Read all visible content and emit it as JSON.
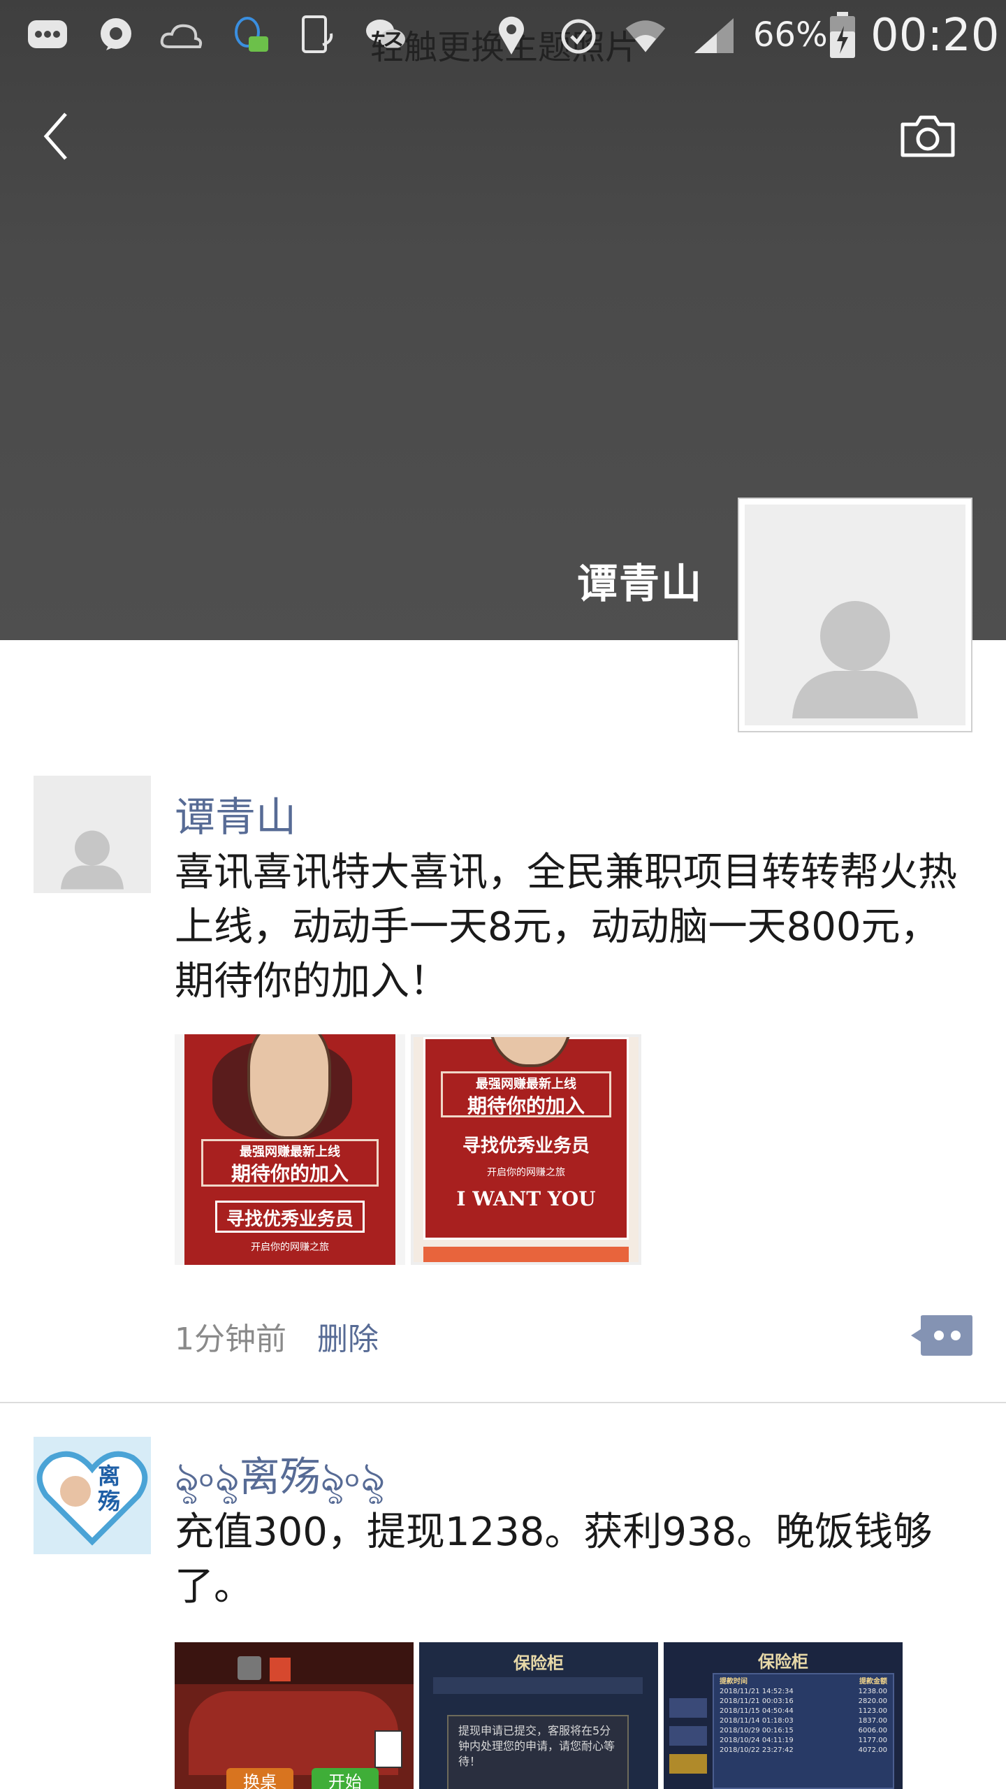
{
  "status_bar": {
    "battery_percent": "66%",
    "time": "00:20",
    "overlay_hint": "轻触更换主题照片",
    "icons": [
      "message-icon",
      "chat-bubble-icon",
      "weather-icon",
      "qq-icon",
      "phone-sync-icon",
      "wechat-icon",
      "location-icon",
      "alarm-icon",
      "wifi-icon",
      "signal-icon",
      "battery-icon"
    ]
  },
  "header": {
    "back_icon": "chevron-left-icon",
    "camera_icon": "camera-icon",
    "cover_name": "谭青山"
  },
  "posts": [
    {
      "author": "谭青山",
      "text": "喜讯喜讯特大喜讯，全民兼职项目转转帮火热上线，动动手一天8元，动动脑一天800元，期待你的加入！",
      "images": [
        {
          "headline": "最强网赚最新上线",
          "title": "期待你的加入",
          "subtitle": "寻找优秀业务员",
          "footer": "开启你的网赚之旅"
        },
        {
          "headline": "最强网赚最新上线",
          "title": "期待你的加入",
          "subtitle": "寻找优秀业务员",
          "footer": "开启你的网赚之旅",
          "tag": "I WANT YOU"
        }
      ],
      "time": "1分钟前",
      "delete_label": "删除"
    },
    {
      "author": "ৡ৹ৡ离殇ৡ৹ৡ",
      "avatar_text": "离殇",
      "text": "充值300，提现1238。获利938。晚饭钱够了。",
      "images": [
        {
          "label_left": "换桌",
          "label_right": "开始"
        },
        {
          "title": "保险柜",
          "notice": "提现申请已提交，客服将在5分钟内处理您的申请，请您耐心等待！"
        },
        {
          "title": "保险柜",
          "col1": "提款时间",
          "col2": "提款金额",
          "rows": [
            [
              "2018/11/21 14:52:34",
              "1238.00"
            ],
            [
              "2018/11/21 00:03:16",
              "2820.00"
            ],
            [
              "2018/11/15 04:50:44",
              "1123.00"
            ],
            [
              "2018/11/14 01:18:03",
              "1837.00"
            ],
            [
              "2018/10/29 00:16:15",
              "6006.00"
            ],
            [
              "2018/10/24 04:11:19",
              "1177.00"
            ],
            [
              "2018/10/22 23:27:42",
              "4072.00"
            ]
          ]
        }
      ]
    }
  ]
}
